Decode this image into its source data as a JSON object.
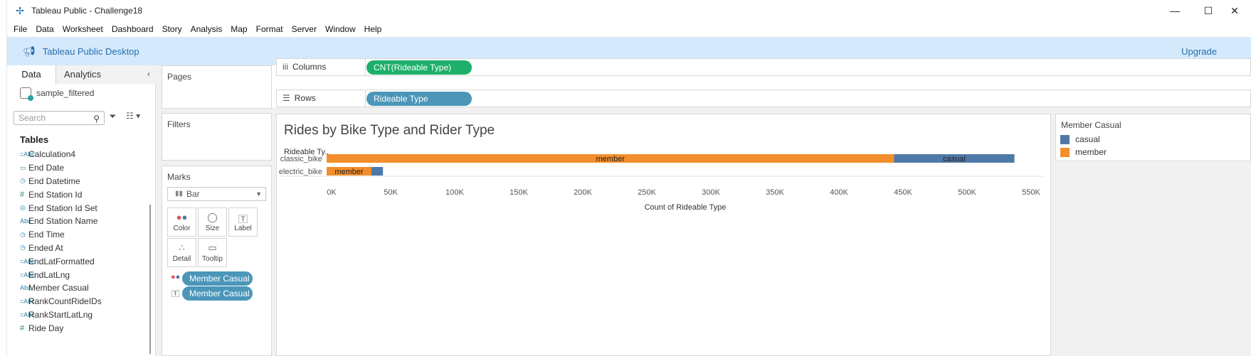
{
  "window": {
    "title": "Tableau Public - Challenge18",
    "minimize": "—",
    "maximize": "☐",
    "close": "✕"
  },
  "menu": [
    "File",
    "Data",
    "Worksheet",
    "Dashboard",
    "Story",
    "Analysis",
    "Map",
    "Format",
    "Server",
    "Window",
    "Help"
  ],
  "banner": {
    "title": "Tableau Public Desktop",
    "upgrade": "Upgrade"
  },
  "data_pane": {
    "tabs": [
      "Data",
      "Analytics"
    ],
    "datasource": "sample_filtered",
    "search_placeholder": "Search",
    "tables_heading": "Tables",
    "fields": [
      {
        "icon": "=Abc",
        "name": "Calculation4"
      },
      {
        "icon": "date-icon",
        "name": "End Date"
      },
      {
        "icon": "datetime-icon",
        "name": "End Datetime"
      },
      {
        "icon": "#",
        "name": "End Station Id"
      },
      {
        "icon": "set-icon",
        "name": "End Station Id Set"
      },
      {
        "icon": "Abc",
        "name": "End Station Name"
      },
      {
        "icon": "datetime-icon",
        "name": "End Time"
      },
      {
        "icon": "datetime-icon",
        "name": "Ended At"
      },
      {
        "icon": "=Abc",
        "name": "EndLatFormatted"
      },
      {
        "icon": "=Abc",
        "name": "EndLatLng"
      },
      {
        "icon": "Abc",
        "name": "Member Casual"
      },
      {
        "icon": "=Abc",
        "name": "RankCountRideIDs"
      },
      {
        "icon": "=Abc",
        "name": "RankStartLatLng"
      },
      {
        "icon": "#",
        "name": "Ride Day"
      }
    ]
  },
  "cards": {
    "pages": "Pages",
    "filters": "Filters",
    "marks": "Marks",
    "mark_type": "Bar",
    "mark_buttons": [
      "Color",
      "Size",
      "Label",
      "Detail",
      "Tooltip"
    ],
    "mark_pills": [
      "Member Casual",
      "Member Casual"
    ]
  },
  "shelves": {
    "columns_label": "Columns",
    "columns_pill": "CNT(Rideable Type)",
    "rows_label": "Rows",
    "rows_pill": "Rideable Type"
  },
  "view": {
    "title": "Rides by Bike Type and Rider Type"
  },
  "legend": {
    "title": "Member Casual",
    "items": [
      {
        "label": "casual",
        "color": "#4e79a7"
      },
      {
        "label": "member",
        "color": "#f28e2b"
      }
    ]
  },
  "chart_data": {
    "type": "bar",
    "orientation": "horizontal-stacked",
    "row_header": "Rideable Ty..",
    "categories": [
      "classic_bike",
      "electric_bike"
    ],
    "series": [
      {
        "name": "member",
        "color": "#f28e2b",
        "values": [
          443000,
          35000
        ]
      },
      {
        "name": "casual",
        "color": "#4e79a7",
        "values": [
          94000,
          9000
        ]
      }
    ],
    "segment_labels": [
      [
        "member",
        "casual"
      ],
      [
        "member",
        ""
      ]
    ],
    "xlabel": "Count of Rideable Type",
    "xlim": [
      0,
      560000
    ],
    "xticks": [
      0,
      50000,
      100000,
      150000,
      200000,
      250000,
      300000,
      350000,
      400000,
      450000,
      500000,
      550000
    ],
    "xtick_labels": [
      "0K",
      "50K",
      "100K",
      "150K",
      "200K",
      "250K",
      "300K",
      "350K",
      "400K",
      "450K",
      "500K",
      "550K"
    ]
  }
}
